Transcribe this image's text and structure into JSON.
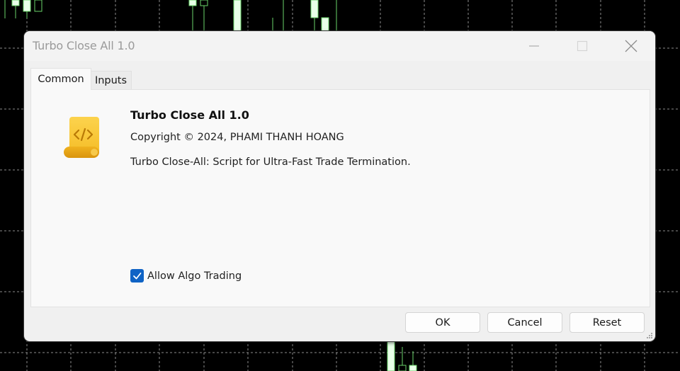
{
  "background": {
    "description": "trading chart candlesticks behind dialog",
    "bull_color": "#6ad46a",
    "body_fill": "#e8ffe8",
    "grid_color": "#8c8c8c"
  },
  "dialog": {
    "title": "Turbo Close All 1.0",
    "window_controls": [
      "minimize-icon",
      "maximize-icon",
      "close-icon"
    ],
    "tabs": [
      {
        "label": "Common",
        "active": true
      },
      {
        "label": "Inputs",
        "active": false
      }
    ],
    "script": {
      "icon": "script-scroll-code-icon",
      "icon_color": "#f5c02c",
      "name": "Turbo Close All 1.0",
      "copyright": "Copyright © 2024, PHAMI THANH HOANG",
      "description": "Turbo Close-All: Script for Ultra-Fast Trade Termination."
    },
    "allow_algo_trading": {
      "label": "Allow Algo Trading",
      "checked": true,
      "accent": "#0f63c5"
    },
    "buttons": {
      "ok": "OK",
      "cancel": "Cancel",
      "reset": "Reset"
    }
  }
}
